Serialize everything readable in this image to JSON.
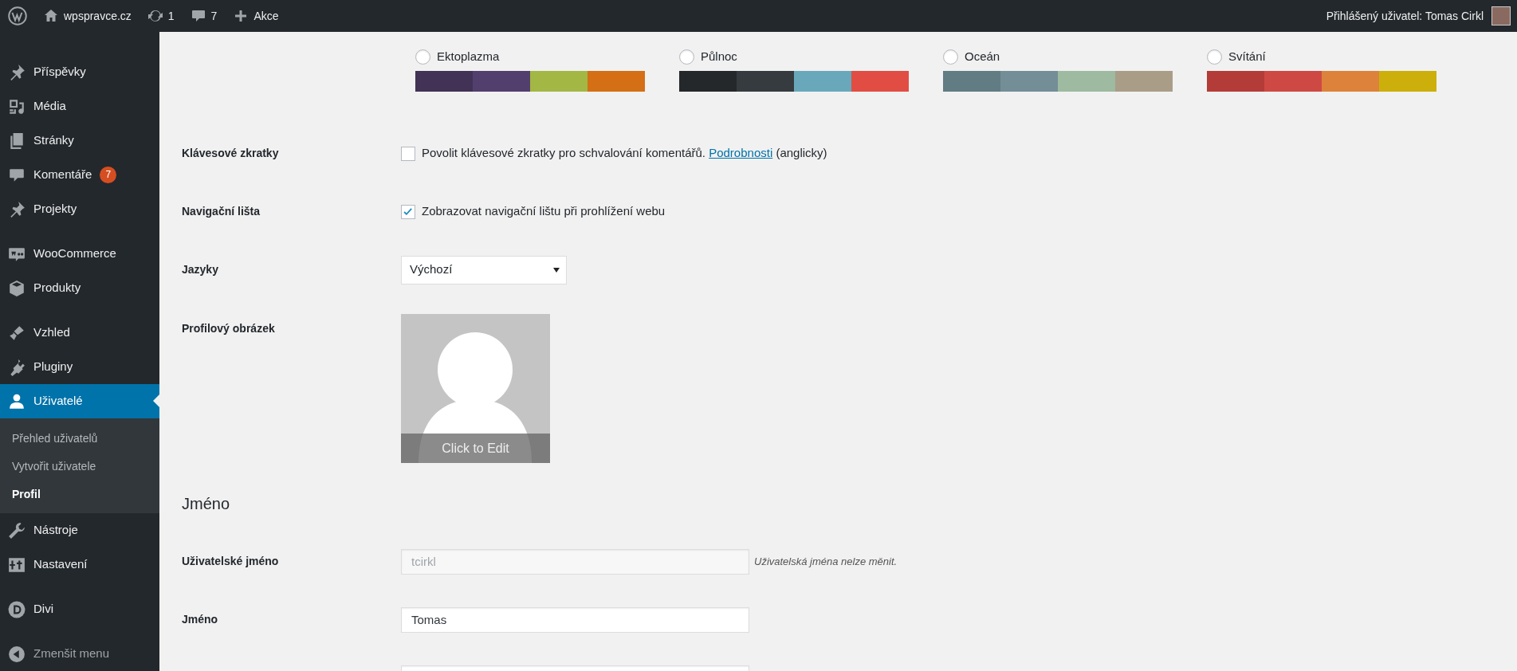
{
  "admin_bar": {
    "site": "wpspravce.cz",
    "updates": "1",
    "comments": "7",
    "new": "Akce",
    "account": "Přihlášený uživatel: Tomas Cirkl"
  },
  "sidebar": {
    "groups": [
      [
        {
          "label": "Příspěvky",
          "selected": false
        },
        {
          "label": "Média",
          "selected": false
        },
        {
          "label": "Stránky",
          "selected": false
        },
        {
          "label": "Komentáře",
          "selected": false,
          "badge": "7"
        },
        {
          "label": "Projekty",
          "selected": false
        }
      ],
      [
        {
          "label": "WooCommerce",
          "selected": false
        },
        {
          "label": "Produkty",
          "selected": false
        }
      ],
      [
        {
          "label": "Vzhled",
          "selected": false
        },
        {
          "label": "Pluginy",
          "selected": false
        },
        {
          "label": "Uživatelé",
          "selected": true,
          "children": [
            {
              "label": "Přehled uživatelů",
              "selected": false
            },
            {
              "label": "Vytvořit uživatele",
              "selected": false
            },
            {
              "label": "Profil",
              "selected": true
            }
          ]
        },
        {
          "label": "Nástroje",
          "selected": false
        },
        {
          "label": "Nastavení",
          "selected": false
        }
      ],
      [
        {
          "label": "Divi",
          "selected": false
        }
      ]
    ],
    "collapse": "Zmenšit menu"
  },
  "color_schemes": [
    {
      "name": "Ektoplazma",
      "selected": false,
      "swatches": [
        {
          "color": "#413256"
        },
        {
          "color": "#523f6d"
        },
        {
          "color": "#a3b745"
        },
        {
          "color": "#d46f15"
        }
      ]
    },
    {
      "name": "Půlnoc",
      "selected": false,
      "swatches": [
        {
          "color": "#25282b"
        },
        {
          "color": "#363b3f"
        },
        {
          "color": "#69a8bb"
        },
        {
          "color": "#e14d43"
        }
      ]
    },
    {
      "name": "Oceán",
      "selected": false,
      "swatches": [
        {
          "color": "#627c83"
        },
        {
          "color": "#738e96"
        },
        {
          "color": "#9ebaa0"
        },
        {
          "color": "#aa9d88"
        }
      ]
    },
    {
      "name": "Svítání",
      "selected": false,
      "swatches": [
        {
          "color": "#b43c38"
        },
        {
          "color": "#cf4944"
        },
        {
          "color": "#dd823b"
        },
        {
          "color": "#ccaf0b"
        }
      ]
    }
  ],
  "form": [
    {
      "kind": "checkbox",
      "label": "Klávesové zkratky",
      "checked": false,
      "text": "Povolit klávesové zkratky pro schvalování komentářů.",
      "link": "Podrobnosti",
      "after": "(anglicky)"
    },
    {
      "kind": "checkbox",
      "label": "Navigační lišta",
      "checked": true,
      "text": "Zobrazovat navigační lištu při prohlížení webu"
    },
    {
      "kind": "select",
      "label": "Jazyky",
      "value": "Výchozí"
    },
    {
      "kind": "avatar",
      "label": "Profilový obrázek",
      "caption": "Click to Edit"
    },
    {
      "kind": "heading",
      "label": "Jméno"
    },
    {
      "kind": "text",
      "label": "Uživatelské jméno",
      "value": "tcirkl",
      "disabled": true,
      "note": "Uživatelská jména nelze měnit."
    },
    {
      "kind": "text",
      "label": "Jméno",
      "value": "Tomas",
      "disabled": false
    },
    {
      "kind": "text"
    }
  ]
}
